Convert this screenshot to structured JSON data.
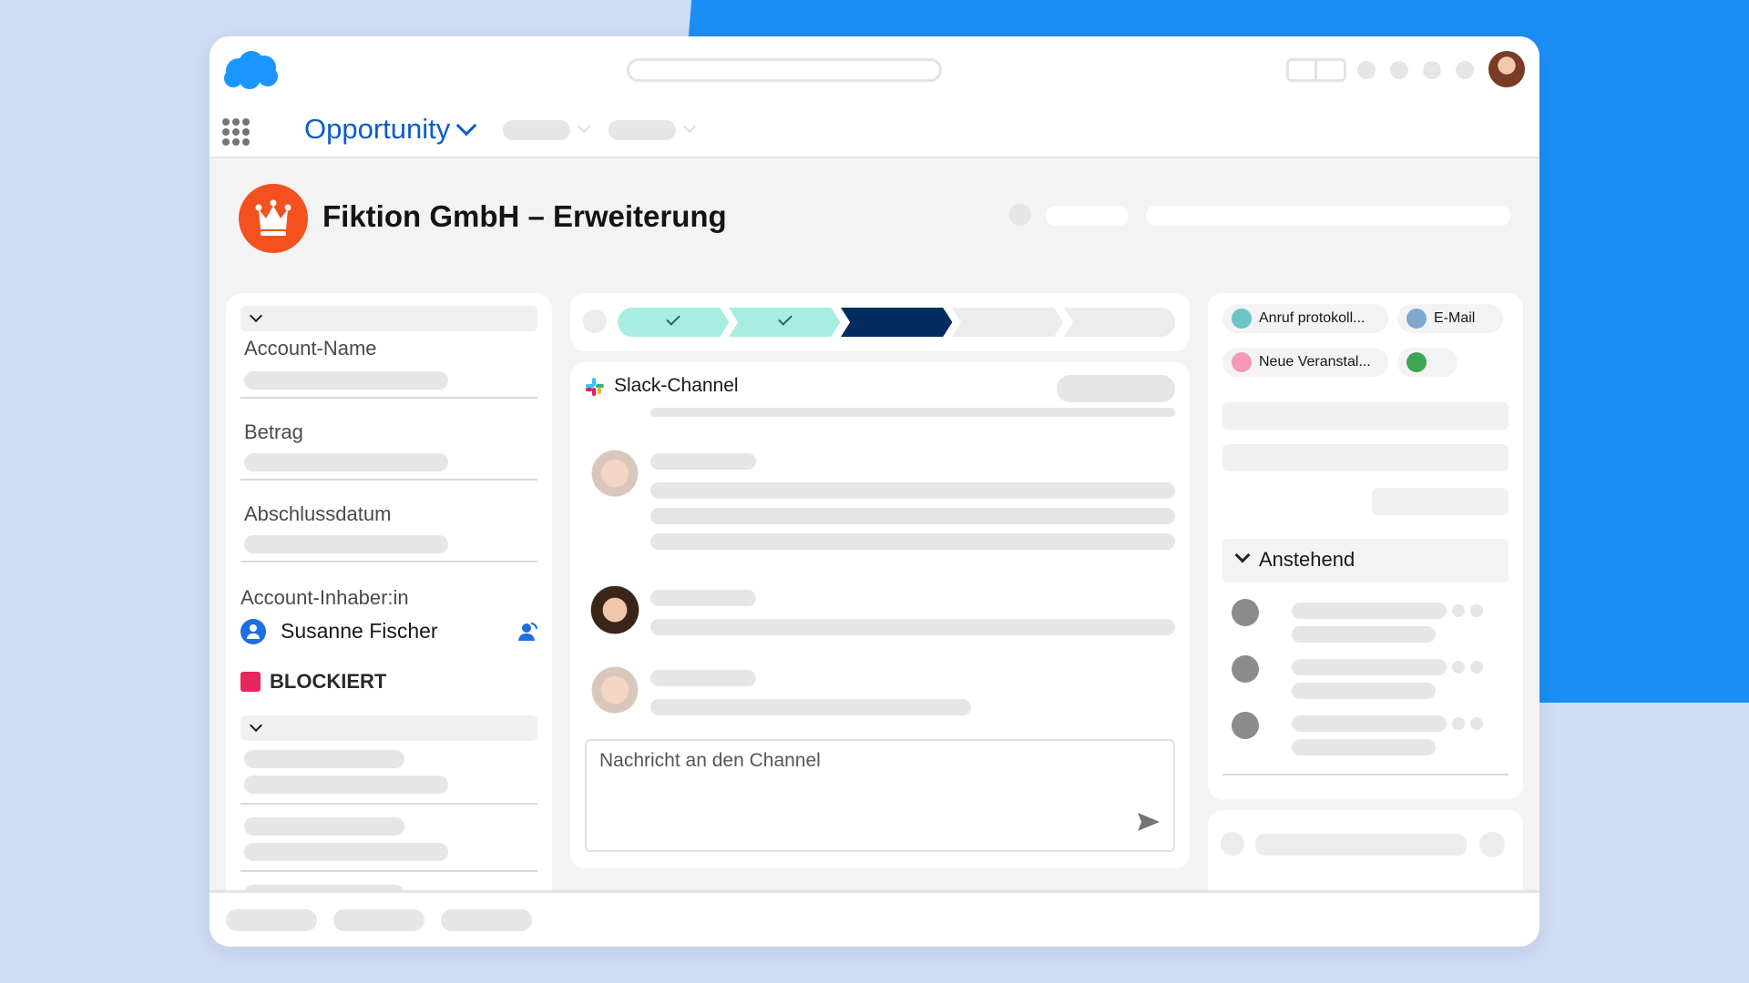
{
  "nav": {
    "object_name": "Opportunity"
  },
  "record": {
    "title": "Fiktion GmbH – Erweiterung"
  },
  "details": {
    "account_name_label": "Account-Name",
    "amount_label": "Betrag",
    "close_date_label": "Abschlussdatum",
    "owner_label": "Account-Inhaber:in",
    "owner_name": "Susanne Fischer",
    "blocked_label": "BLOCKIERT"
  },
  "slack": {
    "channel_title": "Slack-Channel",
    "input_placeholder": "Nachricht an den Channel"
  },
  "activity": {
    "log_call": "Anruf protokoll...",
    "email": "E-Mail",
    "new_event": "Neue Veranstal...",
    "upcoming": "Anstehend"
  },
  "colors": {
    "brand": "#1b8ef5",
    "accent_blue": "#0b5cc9",
    "path_done": "#a9ece1",
    "path_current": "#032d60",
    "blocked": "#e8265e",
    "crown": "#f4511e"
  },
  "path_steps": [
    {
      "status": "done"
    },
    {
      "status": "done"
    },
    {
      "status": "current"
    },
    {
      "status": "todo"
    },
    {
      "status": "todo"
    }
  ]
}
